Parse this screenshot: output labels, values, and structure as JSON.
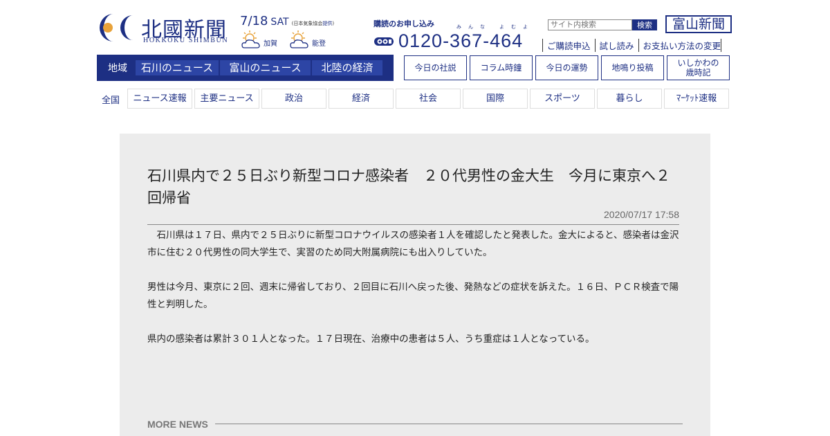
{
  "header": {
    "logo_title": "北國新聞",
    "logo_roman": "HOKKOKU SHIMBUN",
    "date": "7/18",
    "weekday": "SAT",
    "weather_source_prefix": "(日本気象協会",
    "weather_source_link": "提供",
    "weather_source_suffix": ")",
    "weather": [
      {
        "place": "加賀",
        "icon": "sun-behind-cloud-icon"
      },
      {
        "place": "能登",
        "icon": "sun-behind-cloud-icon"
      }
    ],
    "subscribe_label": "購読のお申し込み",
    "phone_ruby_1": "みんな",
    "phone_ruby_2": "よむよ",
    "phone_number": "0120-367-464",
    "search_placeholder": "サイト内検索",
    "search_button": "検索",
    "toyama_link": "富山新聞",
    "links": [
      "ご購読申込",
      "試し読み",
      "お支払い方法の変更"
    ]
  },
  "region_nav": {
    "label": "地域",
    "tabs": [
      "石川のニュース",
      "富山のニュース",
      "北陸の経済"
    ]
  },
  "feature_nav": [
    {
      "line1": "今日の社説",
      "line2": ""
    },
    {
      "line1": "コラム時鐘",
      "line2": ""
    },
    {
      "line1": "今日の運勢",
      "line2": ""
    },
    {
      "line1": "地鳴り投稿",
      "line2": ""
    },
    {
      "line1": "いしかわの",
      "line2": "歳時記"
    }
  ],
  "category_nav": {
    "label": "全国",
    "items": [
      "ニュース速報",
      "主要ニュース",
      "政治",
      "経済",
      "社会",
      "国際",
      "スポーツ",
      "暮らし",
      "ﾏｰｹｯﾄ速報"
    ]
  },
  "article": {
    "headline": "石川県内で２５日ぶり新型コロナ感染者　２０代男性の金大生　今月に東京へ２回帰省",
    "published": "2020/07/17 17:58",
    "paragraphs": [
      "　石川県は１７日、県内で２５日ぶりに新型コロナウイルスの感染者１人を確認したと発表した。金大によると、感染者は金沢市に住む２０代男性の同大学生で、実習のため同大附属病院にも出入りしていた。",
      "男性は今月、東京に２回、週末に帰省しており、２回目に石川へ戻った後、発熱などの症状を訴えた。１６日、ＰＣＲ検査で陽性と判明した。",
      "県内の感染者は累計３０１人となった。１７日現在、治療中の患者は５人、うち重症は１人となっている。"
    ]
  },
  "more_news_label": "MORE NEWS",
  "colors": {
    "brand_navy": "#1d2f83",
    "tab_blue": "#2d45a5",
    "article_bg": "#ececec",
    "logo_orange": "#e8a23a"
  }
}
